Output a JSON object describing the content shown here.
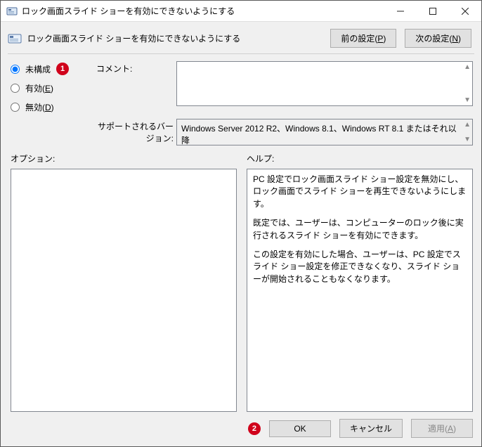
{
  "window": {
    "title": "ロック画面スライド ショーを有効にできないようにする"
  },
  "header": {
    "title": "ロック画面スライド ショーを有効にできないようにする",
    "prev_label_prefix": "前の設定(",
    "prev_key": "P",
    "prev_label_suffix": ")",
    "next_label_prefix": "次の設定(",
    "next_key": "N",
    "next_label_suffix": ")"
  },
  "radios": {
    "not_configured": "未構成",
    "enabled_prefix": "有効(",
    "enabled_key": "E",
    "enabled_suffix": ")",
    "disabled_prefix": "無効(",
    "disabled_key": "D",
    "disabled_suffix": ")"
  },
  "labels": {
    "comment": "コメント:",
    "supported": "サポートされるバージョン:",
    "options": "オプション:",
    "help": "ヘルプ:"
  },
  "values": {
    "comment": "",
    "supported": "Windows Server 2012 R2、Windows 8.1、Windows RT 8.1 またはそれ以降"
  },
  "help": {
    "p1": "PC 設定でロック画面スライド ショー設定を無効にし、ロック画面でスライド ショーを再生できないようにします。",
    "p2": "既定では、ユーザーは、コンピューターのロック後に実行されるスライド ショーを有効にできます。",
    "p3": "この設定を有効にした場合、ユーザーは、PC 設定でスライド ショー設定を修正できなくなり、スライド ショーが開始されることもなくなります。"
  },
  "footer": {
    "ok": "OK",
    "cancel": "キャンセル",
    "apply_prefix": "適用(",
    "apply_key": "A",
    "apply_suffix": ")"
  },
  "callouts": {
    "one": "1",
    "two": "2"
  }
}
